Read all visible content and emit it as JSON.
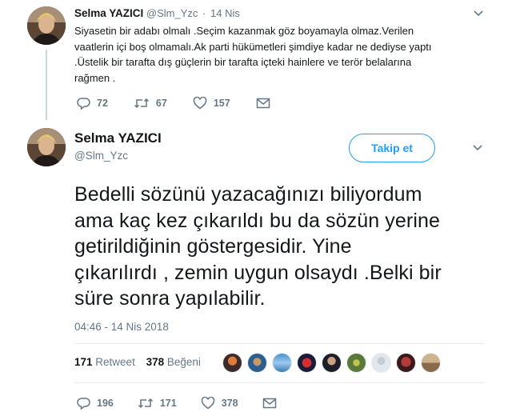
{
  "reply_tweet": {
    "name": "Selma YAZICI",
    "handle": "@Slm_Yzc",
    "separator": "·",
    "time": "14 Nis",
    "lines": [
      "Siyasetin bir adabı olmalı .Seçim kazanmak göz boyamayla olmaz.Verilen",
      "vaatlerin içi boş olmamalı.Ak parti hükümetleri şimdiye kadar ne dediyse yaptı",
      ".Üstelik bir tarafta dış güçlerin bir tarafta içteki hainlere ve terör belalarına",
      "rağmen ."
    ],
    "replies": "72",
    "retweets": "67",
    "likes": "157",
    "icons": [
      "reply-icon",
      "retweet-icon",
      "like-icon",
      "message-icon",
      "chevron-down-icon"
    ]
  },
  "main_tweet": {
    "name": "Selma YAZICI",
    "handle": "@Slm_Yzc",
    "follow_label": "Takip et",
    "lines": [
      "Bedelli sözünü yazacağınızı biliyordum",
      "ama kaç kez çıkarıldı bu da sözün yerine",
      "getirildiğinin göstergesidir. Yine",
      "çıkarılırdı , zemin uygun olsaydı .Belki bir",
      "süre sonra yapılabilir."
    ],
    "datetime": "04:46 - 14 Nis 2018",
    "retweet_count": "171",
    "retweet_label": "Retweet",
    "like_count": "378",
    "like_label": "Beğeni",
    "action_replies": "196",
    "action_retweets": "171",
    "action_likes": "378",
    "icons": [
      "reply-icon",
      "retweet-icon",
      "like-icon",
      "message-icon",
      "chevron-down-icon"
    ]
  },
  "colors": {
    "accent": "#1da1f2",
    "text": "#14171a",
    "muted": "#657786",
    "divider": "#e6ecf0"
  }
}
